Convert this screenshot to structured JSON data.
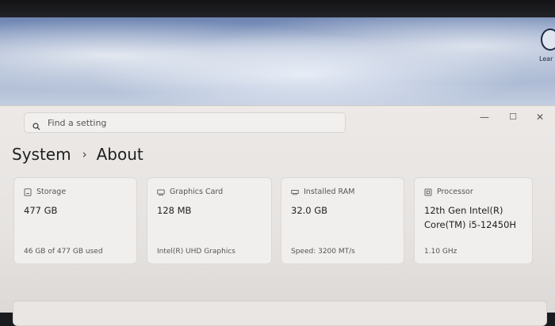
{
  "desktop": {
    "side_text": "Lear this"
  },
  "search": {
    "placeholder": "Find a setting"
  },
  "window_controls": {
    "minimize": "—",
    "maximize": "☐",
    "close": "✕"
  },
  "breadcrumb": {
    "parent": "System",
    "separator": "›",
    "current": "About"
  },
  "specs": [
    {
      "icon": "storage-icon",
      "label": "Storage",
      "value": "477 GB",
      "detail": "46 GB of 477 GB used"
    },
    {
      "icon": "graphics-card-icon",
      "label": "Graphics Card",
      "value": "128 MB",
      "detail": "Intel(R) UHD Graphics"
    },
    {
      "icon": "ram-icon",
      "label": "Installed RAM",
      "value": "32.0 GB",
      "detail": "Speed: 3200 MT/s"
    },
    {
      "icon": "processor-icon",
      "label": "Processor",
      "value": "12th Gen Intel(R)\nCore(TM) i5-12450H",
      "detail": "1.10 GHz"
    }
  ]
}
